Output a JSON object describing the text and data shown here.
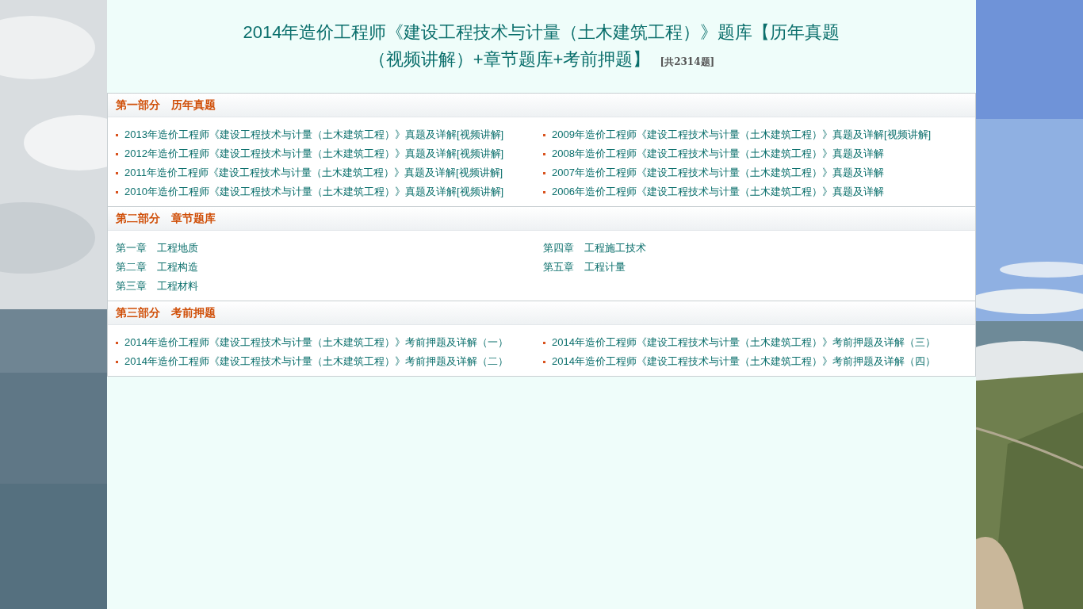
{
  "title": {
    "line1": "2014年造价工程师《建设工程技术与计量（土木建筑工程）》题库【历年真题",
    "line2": "（视频讲解）+章节题库+考前押题】",
    "count": "[共2314题]"
  },
  "sections": [
    {
      "heading": "第一部分　历年真题",
      "kind": "bulleted",
      "columns": [
        [
          "2013年造价工程师《建设工程技术与计量（土木建筑工程）》真题及详解[视频讲解]",
          "2012年造价工程师《建设工程技术与计量（土木建筑工程）》真题及详解[视频讲解]",
          "2011年造价工程师《建设工程技术与计量（土木建筑工程）》真题及详解[视频讲解]",
          "2010年造价工程师《建设工程技术与计量（土木建筑工程）》真题及详解[视频讲解]"
        ],
        [
          "2009年造价工程师《建设工程技术与计量（土木建筑工程）》真题及详解[视频讲解]",
          "2008年造价工程师《建设工程技术与计量（土木建筑工程）》真题及详解",
          "2007年造价工程师《建设工程技术与计量（土木建筑工程）》真题及详解",
          "2006年造价工程师《建设工程技术与计量（土木建筑工程）》真题及详解"
        ]
      ]
    },
    {
      "heading": "第二部分　章节题库",
      "kind": "plain",
      "columns": [
        [
          "第一章　工程地质",
          "第二章　工程构造",
          "第三章　工程材料"
        ],
        [
          "第四章　工程施工技术",
          "第五章　工程计量"
        ]
      ]
    },
    {
      "heading": "第三部分　考前押题",
      "kind": "bulleted",
      "columns": [
        [
          "2014年造价工程师《建设工程技术与计量（土木建筑工程）》考前押题及详解（一）",
          "2014年造价工程师《建设工程技术与计量（土木建筑工程）》考前押题及详解（二）"
        ],
        [
          "2014年造价工程师《建设工程技术与计量（土木建筑工程）》考前押题及详解（三）",
          "2014年造价工程师《建设工程技术与计量（土木建筑工程）》考前押题及详解（四）"
        ]
      ]
    }
  ]
}
